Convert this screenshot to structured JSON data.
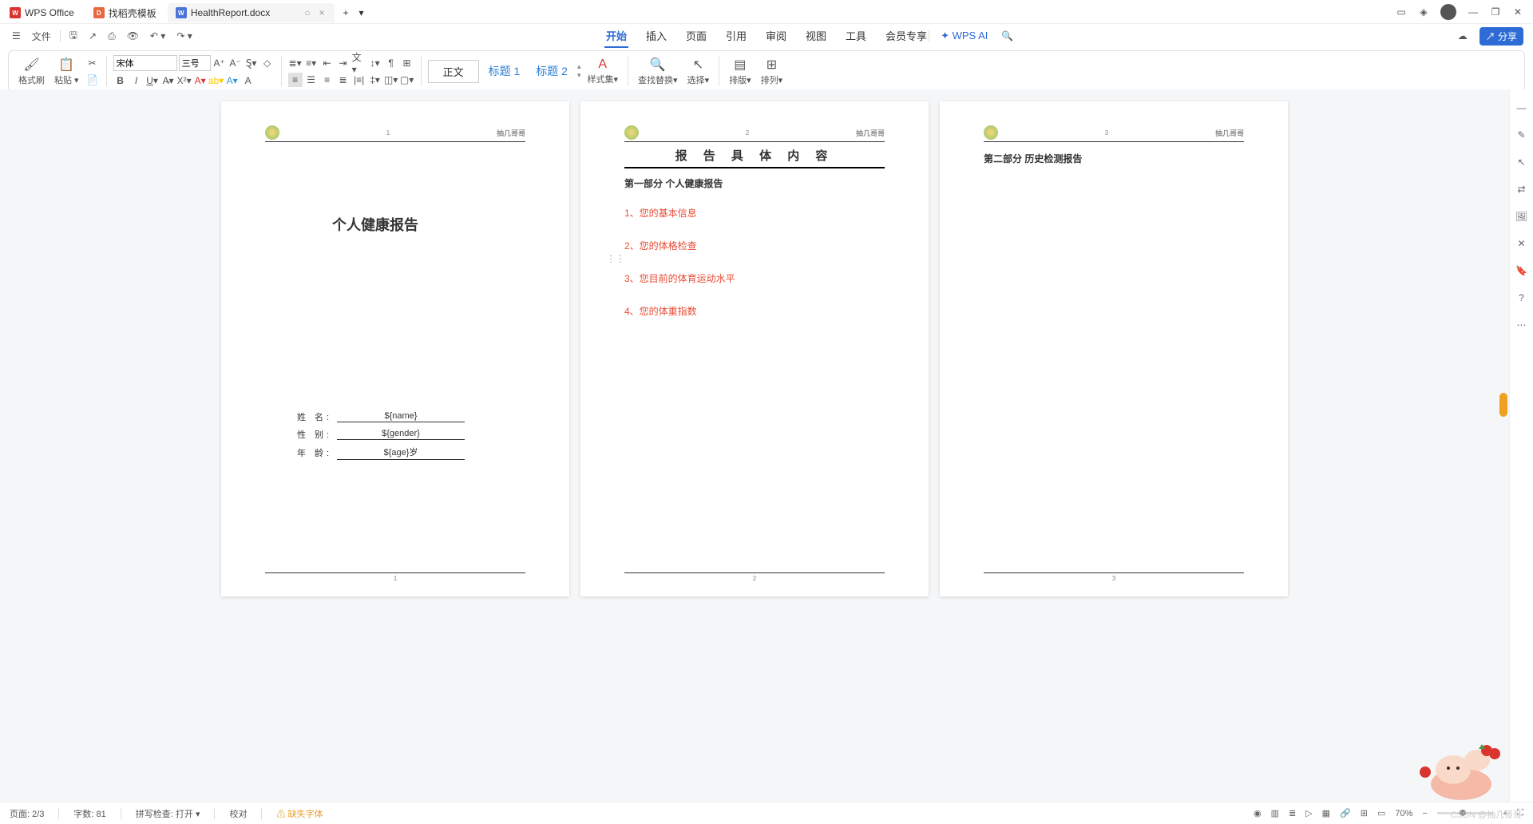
{
  "tabs": {
    "wps": "WPS Office",
    "template": "找稻壳模板",
    "doc": "HealthReport.docx"
  },
  "menu": {
    "file": "文件",
    "start": "开始",
    "insert": "插入",
    "page": "页面",
    "ref": "引用",
    "review": "审阅",
    "view": "视图",
    "tools": "工具",
    "vip": "会员专享",
    "ai": "WPS AI"
  },
  "share": "分享",
  "ribbon": {
    "format": "格式刷",
    "paste": "粘贴",
    "font": "宋体",
    "size": "三号",
    "style_body": "正文",
    "style_h1": "标题 1",
    "style_h2": "标题 2",
    "styleset": "样式集",
    "find": "查找替换",
    "select": "选择",
    "tile": "排版",
    "arrange": "排列"
  },
  "page1": {
    "hdr": "抽几哥哥",
    "title": "个人健康报告",
    "rows": [
      {
        "label": "姓  名:",
        "val": "${name}"
      },
      {
        "label": "性  别:",
        "val": "${gender}"
      },
      {
        "label": "年  龄:",
        "val": "${age}岁"
      }
    ],
    "num": "1"
  },
  "page2": {
    "hdr": "抽几哥哥",
    "title": "报 告 具 体 内 容",
    "sub": "第一部分  个人健康报告",
    "items": [
      "1、您的基本信息",
      "2、您的体格检查",
      "3、您目前的体育运动水平",
      "4、您的体重指数"
    ],
    "num": "2"
  },
  "page3": {
    "hdr": "抽几哥哥",
    "title": "第二部分  历史检测报告",
    "num": "3"
  },
  "status": {
    "page": "页面: 2/3",
    "words": "字数: 81",
    "spell": "拼写检查: 打开",
    "proof": "校对",
    "font_missing": "缺失字体",
    "zoom": "70%"
  },
  "watermark": "CSDN @抽几哥哥"
}
